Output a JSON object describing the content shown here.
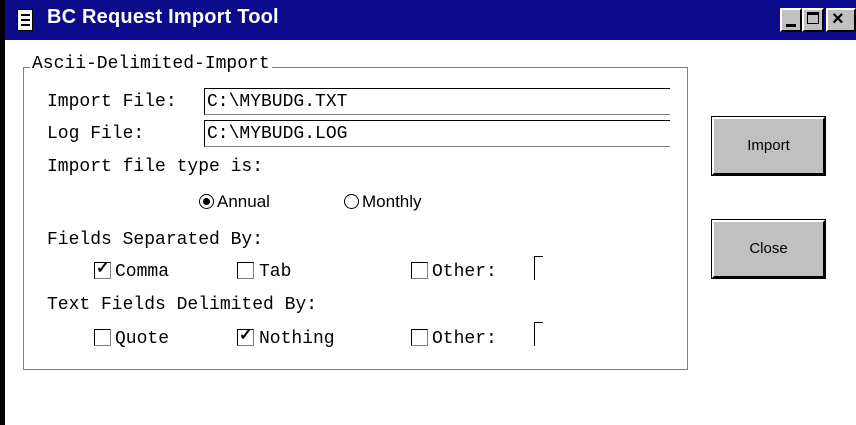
{
  "window": {
    "title": "BC Request Import Tool",
    "title_bar_color": "#0b0b8c",
    "close_glyph": "×"
  },
  "group": {
    "legend": "Ascii-Delimited-Import",
    "import_file_label": "Import File:",
    "import_file_value": "C:\\MYBUDG.TXT",
    "log_file_label": "Log File:",
    "log_file_value": "C:\\MYBUDG.LOG",
    "file_type_label": "Import file type is:",
    "radio_annual": "Annual",
    "radio_monthly": "Monthly",
    "fields_sep_label": "Fields Separated By:",
    "sep_comma": "Comma",
    "sep_tab": "Tab",
    "sep_other": "Other:",
    "text_delim_label": "Text Fields Delimited By:",
    "delim_quote": "Quote",
    "delim_nothing": "Nothing",
    "delim_other": "Other:"
  },
  "buttons": {
    "import": "Import",
    "close": "Close"
  },
  "state": {
    "file_type": "Annual",
    "sep_comma": true,
    "sep_tab": false,
    "sep_other": false,
    "delim_quote": false,
    "delim_nothing": true,
    "delim_other": false
  }
}
